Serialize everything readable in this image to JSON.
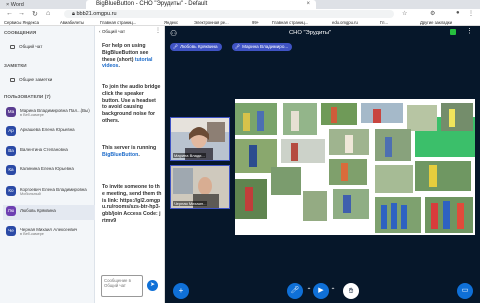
{
  "browser": {
    "left_tab_label": "Word",
    "active_tab_title": "BigBlueButton - СНО \"Эрудиты\" - Default",
    "address": "bbb21.omgpu.ru",
    "bookmarks": [
      "Сервисы Яндекса",
      "Авиабилеты",
      "Главная страниц...",
      "Яндекс",
      "Электронная ре...",
      "99+",
      "Главная страниц...",
      "edu.omgpu.ru",
      "Гл...",
      "Другие закладки"
    ]
  },
  "sidebar": {
    "messages_title": "СООБЩЕНИЯ",
    "public_chat": "Общий чат",
    "notes_title": "ЗАМЕТКИ",
    "shared_notes": "Общие заметки",
    "users_title": "ПОЛЬЗОВАТЕЛИ (7)",
    "users": [
      {
        "initials": "Ма",
        "name": "Марина Владимировна Пал...(Вы)",
        "sub": "в Веб-камере",
        "color": "#5a3d91"
      },
      {
        "initials": "Ар",
        "name": "Аркашева Елена Юрьевна",
        "sub": "",
        "color": "#2b4aa6"
      },
      {
        "initials": "Ва",
        "name": "Валентина Степановна",
        "sub": "",
        "color": "#2b4aa6"
      },
      {
        "initials": "Ка",
        "name": "Калинина Елена Юрьевна",
        "sub": "",
        "color": "#2b4aa6"
      },
      {
        "initials": "Ко",
        "name": "Коргоевич Елена Владимировна",
        "sub": "Мобильный",
        "color": "#2b4aa6"
      },
      {
        "initials": "Лю",
        "name": "Любовь Кряквина",
        "sub": "",
        "color": "#6d3fb1"
      },
      {
        "initials": "Че",
        "name": "Черная Михаил Алексеевич",
        "sub": "в Веб-камере",
        "color": "#2b4aa6"
      }
    ]
  },
  "chat": {
    "title": "Общий чат",
    "msg1_a": "For help on using BigBlueButton see these (short)",
    "msg1_link": "tutorial videos",
    "msg1_b": ".",
    "msg2": "To join the audio bridge click the speaker button. Use a headset to avoid causing background noise for others.",
    "msg3_a": "This server is running",
    "msg3_link": "BigBlueButton",
    "msg3_b": ".",
    "msg4": "To invite someone to the meeting, send them this link: https://gl2.omgpu.ru/rooms/szs-btr-hp3-gbb/join Access Code: jrtmv9",
    "input_placeholder": "Сообщение в Общий чат",
    "send_icon": "send-icon"
  },
  "meeting": {
    "title": "СНО \"Эрудиты\"",
    "talkers": [
      "Любовь Кряквина",
      "Марина Владимиро..."
    ],
    "cameras": [
      {
        "label": "Марина Влади..."
      },
      {
        "label": "Черная Михаил..."
      }
    ],
    "accent": "#3f53c4",
    "green": "#26bf3e"
  },
  "actions": {
    "add_icon": "plus-icon",
    "mic_icon": "microphone-icon",
    "video_icon": "video-icon",
    "screen_icon": "screen-share-icon",
    "raise_icon": "raise-hand-icon",
    "present_icon": "presentation-icon"
  }
}
